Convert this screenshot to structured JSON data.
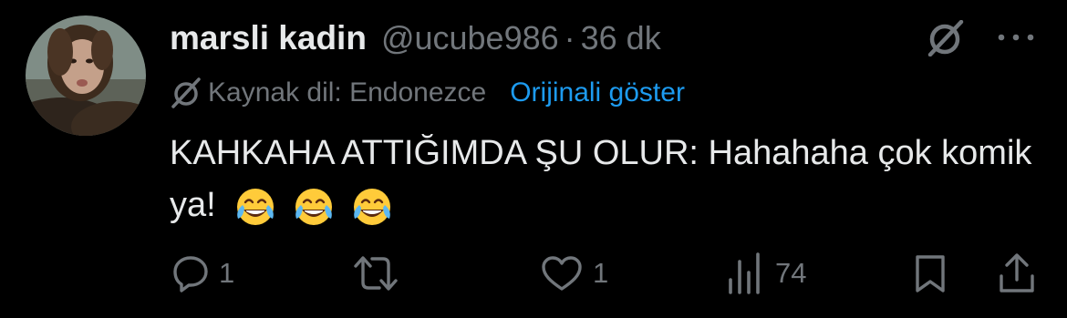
{
  "tweet": {
    "display_name": "marsli kadin",
    "handle": "@ucube986",
    "separator": "·",
    "time": "36 dk",
    "translation": {
      "source_label": "Kaynak dil: Endonezce",
      "show_original_label": "Orijinali göster"
    },
    "text": "KAHKAHA ATTIĞIMDA ŞU OLUR: Hahahaha çok komik ya!",
    "emojis": [
      "face-with-tears-of-joy",
      "face-with-tears-of-joy",
      "face-with-tears-of-joy"
    ]
  },
  "actions": {
    "reply_count": "1",
    "retweet_count": "",
    "like_count": "1",
    "views_count": "74"
  },
  "icons": {
    "grok": "grok-icon",
    "more": "more-dots-icon",
    "translate": "translate-icon",
    "reply": "reply-icon",
    "retweet": "retweet-icon",
    "like": "heart-icon",
    "views": "views-bar-chart-icon",
    "bookmark": "bookmark-icon",
    "share": "share-icon"
  },
  "colors": {
    "background": "#000000",
    "text_primary": "#e7e9ea",
    "text_secondary": "#71767b",
    "link": "#1d9bf0"
  }
}
